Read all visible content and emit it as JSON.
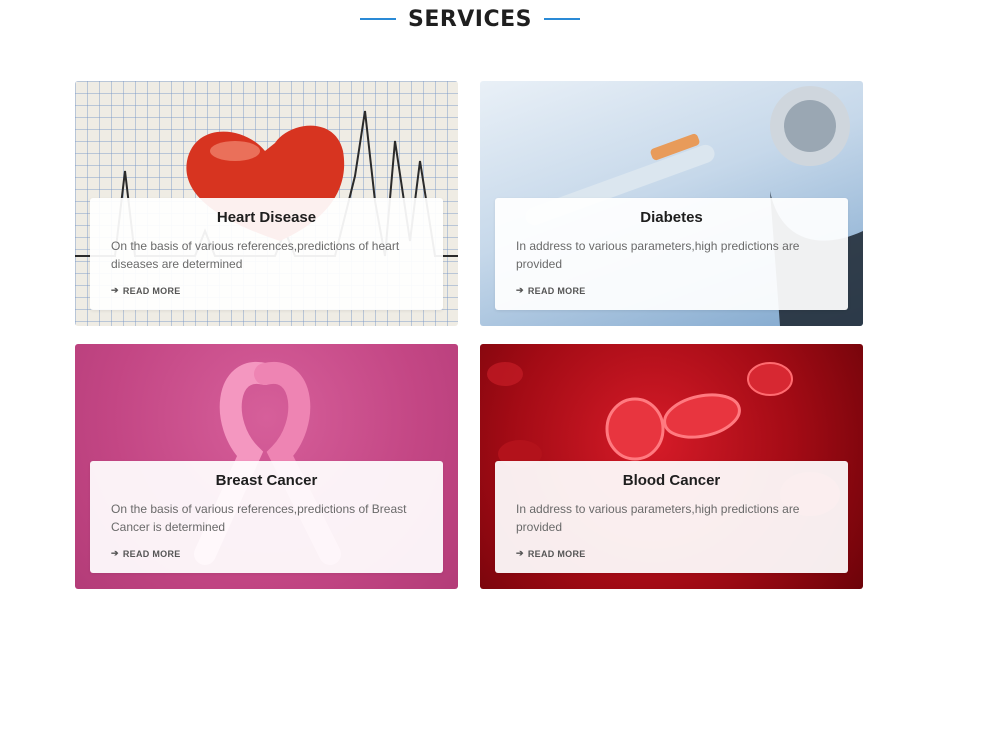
{
  "section": {
    "title": "SERVICES"
  },
  "colors": {
    "accent": "#2a8ad6"
  },
  "cards": [
    {
      "title": "Heart Disease",
      "description": "On the basis of various references,predictions of heart diseases are determined",
      "link": "READ MORE",
      "image_icon": "heart-ecg-image"
    },
    {
      "title": "Diabetes",
      "description": "In address to various parameters,high predictions are provided",
      "link": "READ MORE",
      "image_icon": "syringe-stethoscope-image"
    },
    {
      "title": "Breast Cancer",
      "description": "On the basis of various references,predictions of Breast Cancer is determined",
      "link": "READ MORE",
      "image_icon": "pink-ribbon-image"
    },
    {
      "title": "Blood Cancer",
      "description": "In address to various parameters,high predictions are provided",
      "link": "READ MORE",
      "image_icon": "blood-cells-image"
    }
  ]
}
